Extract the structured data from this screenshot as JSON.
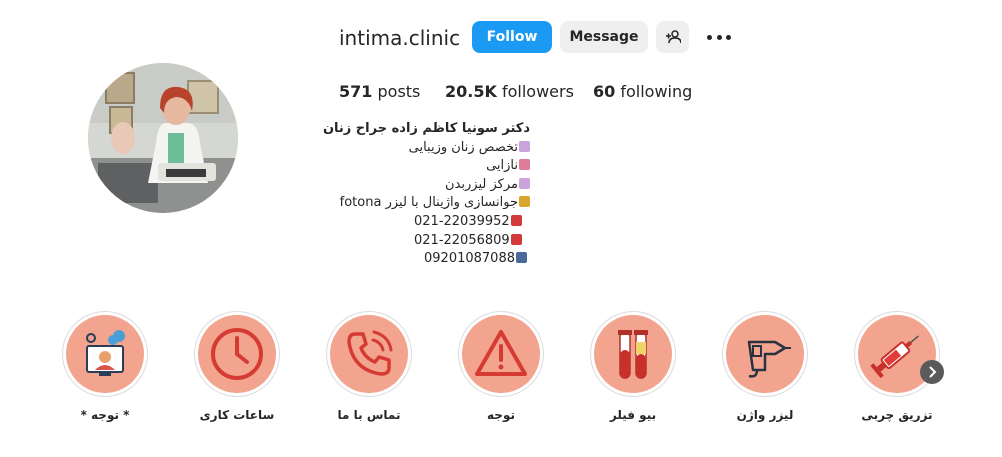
{
  "profile": {
    "username": "intima.clinic",
    "follow_label": "Follow",
    "message_label": "Message",
    "add_user_icon": "add-user-icon",
    "more_icon": "more-options-icon",
    "stats": {
      "posts_value": "571",
      "posts_label": "posts",
      "followers_value": "20.5K",
      "followers_label": "followers",
      "following_value": "60",
      "following_label": "following"
    },
    "bio": {
      "name": "دکتر سونیا کاظم زاده جراح زنان",
      "line1": "تخصص زنان وزیبایی",
      "line2": "نازایی",
      "line3": "مرکز لیزربدن",
      "line4": "جوانسازی واژینال با لیزر fotona",
      "phone1": "021-22039952",
      "phone2": "021-22056809",
      "mobile": "09201087088"
    },
    "accent_color": "#1a9af2"
  },
  "highlights": [
    {
      "label": "تزریق چربی",
      "icon": "syringe-icon"
    },
    {
      "label": "لیزر واژن",
      "icon": "laser-device-icon"
    },
    {
      "label": "بیو فیلر",
      "icon": "test-tubes-icon"
    },
    {
      "label": "توجه",
      "icon": "warning-icon"
    },
    {
      "label": "تماس با ما",
      "icon": "phone-icon"
    },
    {
      "label": "ساعات کاری",
      "icon": "clock-icon"
    },
    {
      "label": "* توجه *",
      "icon": "support-agent-icon"
    }
  ],
  "highlight_color": "#f2a48f",
  "next_icon": "chevron-right-icon"
}
